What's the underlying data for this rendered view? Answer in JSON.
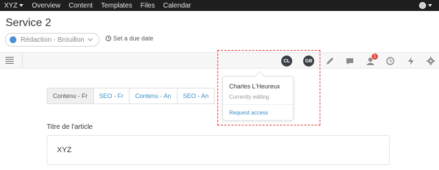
{
  "topnav": {
    "items": [
      "XYZ",
      "Overview",
      "Content",
      "Templates",
      "Files",
      "Calendar"
    ]
  },
  "header": {
    "title": "Service 2",
    "status_label": "Rédaction - Brouillon",
    "due_date_label": "Set a due date"
  },
  "toolbar": {
    "avatars": [
      "CL",
      "GB"
    ],
    "notification_count": "1"
  },
  "tabs": [
    "Contenu - Fr",
    "SEO - Fr",
    "Contenu - An",
    "SEO - An"
  ],
  "field": {
    "label": "Titre de l'article",
    "value": "XYZ"
  },
  "popover": {
    "name": "Charles L'Heureux",
    "status": "Currently editing",
    "link": "Request access"
  },
  "colors": {
    "accent": "#3a8fc8",
    "status_dot": "#4a90d9",
    "badge": "#e5483b",
    "highlight": "#d9302c"
  }
}
